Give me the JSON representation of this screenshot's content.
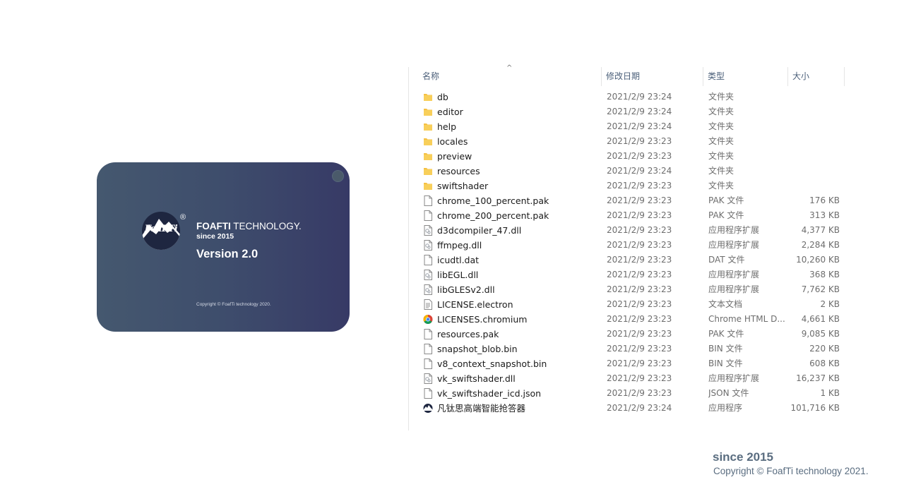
{
  "splash": {
    "logo_text": "FoaFTi",
    "registered_mark": "®",
    "brand_bold": "FOAFTI",
    "brand_rest": " TECHNOLOGY.",
    "since": "since 2015",
    "version": "Version 2.0",
    "copyright": "Copyright © FoafTi technology 2020."
  },
  "explorer": {
    "columns": {
      "name": "名称",
      "date": "修改日期",
      "type": "类型",
      "size": "大小"
    },
    "sort_indicator": "^",
    "files": [
      {
        "name": "db",
        "date": "2021/2/9 23:24",
        "type": "文件夹",
        "size": "",
        "icon": "folder-icon"
      },
      {
        "name": "editor",
        "date": "2021/2/9 23:24",
        "type": "文件夹",
        "size": "",
        "icon": "folder-icon"
      },
      {
        "name": "help",
        "date": "2021/2/9 23:24",
        "type": "文件夹",
        "size": "",
        "icon": "folder-icon"
      },
      {
        "name": "locales",
        "date": "2021/2/9 23:23",
        "type": "文件夹",
        "size": "",
        "icon": "folder-icon"
      },
      {
        "name": "preview",
        "date": "2021/2/9 23:23",
        "type": "文件夹",
        "size": "",
        "icon": "folder-icon"
      },
      {
        "name": "resources",
        "date": "2021/2/9 23:24",
        "type": "文件夹",
        "size": "",
        "icon": "folder-icon"
      },
      {
        "name": "swiftshader",
        "date": "2021/2/9 23:23",
        "type": "文件夹",
        "size": "",
        "icon": "folder-icon"
      },
      {
        "name": "chrome_100_percent.pak",
        "date": "2021/2/9 23:23",
        "type": "PAK 文件",
        "size": "176 KB",
        "icon": "file-icon"
      },
      {
        "name": "chrome_200_percent.pak",
        "date": "2021/2/9 23:23",
        "type": "PAK 文件",
        "size": "313 KB",
        "icon": "file-icon"
      },
      {
        "name": "d3dcompiler_47.dll",
        "date": "2021/2/9 23:23",
        "type": "应用程序扩展",
        "size": "4,377 KB",
        "icon": "dll-icon"
      },
      {
        "name": "ffmpeg.dll",
        "date": "2021/2/9 23:23",
        "type": "应用程序扩展",
        "size": "2,284 KB",
        "icon": "dll-icon"
      },
      {
        "name": "icudtl.dat",
        "date": "2021/2/9 23:23",
        "type": "DAT 文件",
        "size": "10,260 KB",
        "icon": "file-icon"
      },
      {
        "name": "libEGL.dll",
        "date": "2021/2/9 23:23",
        "type": "应用程序扩展",
        "size": "368 KB",
        "icon": "dll-icon"
      },
      {
        "name": "libGLESv2.dll",
        "date": "2021/2/9 23:23",
        "type": "应用程序扩展",
        "size": "7,762 KB",
        "icon": "dll-icon"
      },
      {
        "name": "LICENSE.electron",
        "date": "2021/2/9 23:23",
        "type": "文本文档",
        "size": "2 KB",
        "icon": "text-file-icon"
      },
      {
        "name": "LICENSES.chromium",
        "date": "2021/2/9 23:23",
        "type": "Chrome HTML D...",
        "size": "4,661 KB",
        "icon": "chrome-icon"
      },
      {
        "name": "resources.pak",
        "date": "2021/2/9 23:23",
        "type": "PAK 文件",
        "size": "9,085 KB",
        "icon": "file-icon"
      },
      {
        "name": "snapshot_blob.bin",
        "date": "2021/2/9 23:23",
        "type": "BIN 文件",
        "size": "220 KB",
        "icon": "file-icon"
      },
      {
        "name": "v8_context_snapshot.bin",
        "date": "2021/2/9 23:23",
        "type": "BIN 文件",
        "size": "608 KB",
        "icon": "file-icon"
      },
      {
        "name": "vk_swiftshader.dll",
        "date": "2021/2/9 23:23",
        "type": "应用程序扩展",
        "size": "16,237 KB",
        "icon": "dll-icon"
      },
      {
        "name": "vk_swiftshader_icd.json",
        "date": "2021/2/9 23:23",
        "type": "JSON 文件",
        "size": "1 KB",
        "icon": "file-icon"
      },
      {
        "name": "凡钛思高端智能抢答器",
        "date": "2021/2/9 23:24",
        "type": "应用程序",
        "size": "101,716 KB",
        "icon": "app-icon"
      }
    ]
  },
  "footer": {
    "since": "since 2015",
    "copyright": "Copyright © FoafTi technology 2021."
  },
  "colors": {
    "splash_gradient_start": "#45586f",
    "splash_gradient_end": "#373a66",
    "folder": "#f5c042",
    "header_text": "#4c607a",
    "footer_text": "#5a6d80"
  }
}
